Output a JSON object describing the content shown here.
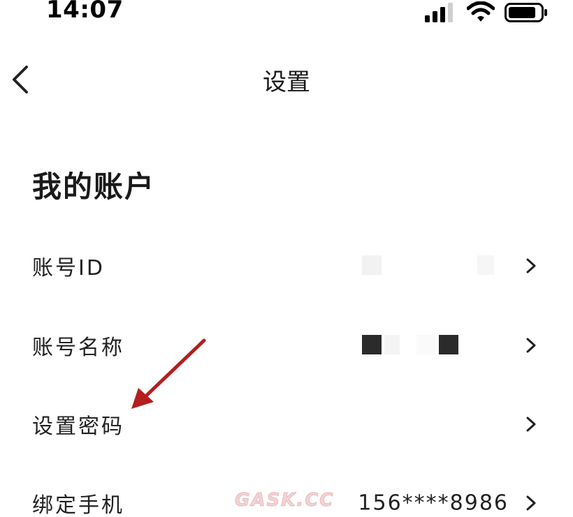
{
  "status_bar": {
    "time": "14:07",
    "icons": [
      "signal-icon",
      "wifi-icon",
      "battery-icon"
    ]
  },
  "nav": {
    "title": "设置",
    "back_icon": "chevron-left-icon"
  },
  "section": {
    "title": "我的账户"
  },
  "rows": [
    {
      "label": "账号ID",
      "value": "",
      "redacted": true
    },
    {
      "label": "账号名称",
      "value": "",
      "redacted": true
    },
    {
      "label": "设置密码",
      "value": ""
    },
    {
      "label": "绑定手机",
      "value": "156****8986"
    }
  ],
  "annotation": {
    "arrow_color": "#b41e1e",
    "target": "设置密码"
  },
  "watermark": {
    "text": "GASK.CC"
  },
  "colors": {
    "text": "#1a1a1a",
    "background": "#ffffff",
    "arrow": "#b41e1e"
  }
}
